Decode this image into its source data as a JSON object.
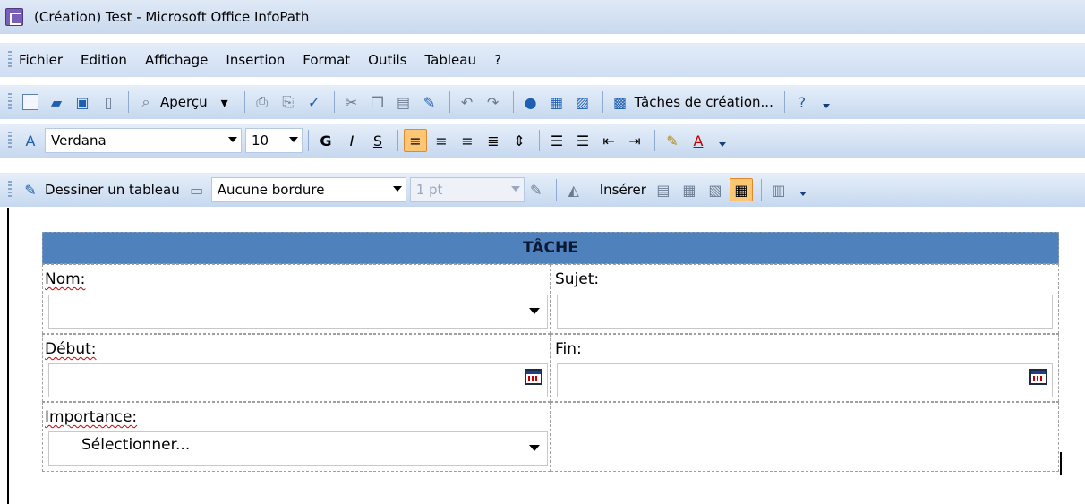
{
  "window": {
    "title": "(Création) Test - Microsoft Office InfoPath"
  },
  "menu": {
    "items": [
      {
        "label": "Fichier"
      },
      {
        "label": "Edition"
      },
      {
        "label": "Affichage"
      },
      {
        "label": "Insertion"
      },
      {
        "label": "Format"
      },
      {
        "label": "Outils"
      },
      {
        "label": "Tableau"
      },
      {
        "label": "?"
      }
    ]
  },
  "toolbar_standard": {
    "preview_label": "Aperçu",
    "design_tasks_label": "Tâches de création..."
  },
  "toolbar_format": {
    "font": "Verdana",
    "size": "10",
    "bold": "G",
    "italic": "I",
    "underline": "S"
  },
  "toolbar_table": {
    "draw_table_label": "Dessiner un tableau",
    "border_style": "Aucune bordure",
    "border_width": "1 pt",
    "insert_label": "Insérer"
  },
  "form": {
    "header": "TÂCHE",
    "nom_label": "Nom:",
    "sujet_label": "Sujet:",
    "debut_label": "Début:",
    "fin_label": "Fin:",
    "importance_label": "Importance:",
    "importance_value": "Sélectionner..."
  },
  "colors": {
    "header_bg": "#4f81bd",
    "toolbar_gradient_top": "#e6eff9",
    "toolbar_gradient_bottom": "#c6d8ef",
    "active_button": "#fdc675"
  }
}
